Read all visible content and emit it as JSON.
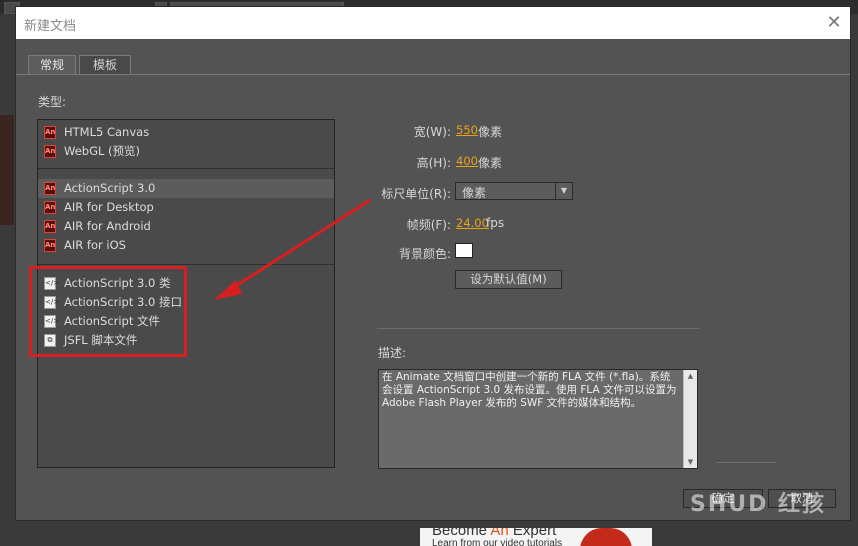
{
  "dialog": {
    "title": "新建文档",
    "close_glyph": "✕"
  },
  "tabs": [
    {
      "label": "常规"
    },
    {
      "label": "模板"
    }
  ],
  "type_section": {
    "label": "类型:",
    "items": [
      {
        "label": "HTML5 Canvas",
        "icon": "animate-document-icon",
        "icon_text": "An"
      },
      {
        "label": "WebGL (预览)",
        "icon": "animate-document-icon",
        "icon_text": "An"
      },
      {
        "label": "ActionScript 3.0",
        "icon": "animate-document-icon",
        "icon_text": "An",
        "selected": true
      },
      {
        "label": "AIR for Desktop",
        "icon": "animate-document-icon",
        "icon_text": "An"
      },
      {
        "label": "AIR for Android",
        "icon": "animate-document-icon",
        "icon_text": "An"
      },
      {
        "label": "AIR for iOS",
        "icon": "animate-document-icon",
        "icon_text": "An"
      },
      {
        "label": "ActionScript 3.0 类",
        "icon": "script-file-icon",
        "icon_text": "</>"
      },
      {
        "label": "ActionScript 3.0 接口",
        "icon": "script-file-icon",
        "icon_text": "</>"
      },
      {
        "label": "ActionScript 文件",
        "icon": "script-file-icon",
        "icon_text": "</>"
      },
      {
        "label": "JSFL 脚本文件",
        "icon": "jsfl-file-icon",
        "icon_text": "⧉"
      }
    ]
  },
  "properties": {
    "width_label": "宽(W):",
    "width_value": "550",
    "width_unit": "像素",
    "height_label": "高(H):",
    "height_value": "400",
    "height_unit": "像素",
    "ruler_label": "标尺单位(R):",
    "ruler_value": "像素",
    "fps_label": "帧频(F):",
    "fps_value": "24.00",
    "fps_unit": "fps",
    "bgcolor_label": "背景颜色:",
    "bgcolor_value": "#ffffff",
    "default_button": "设为默认值(M)"
  },
  "description": {
    "label": "描述:",
    "text": "在 Animate 文档窗口中创建一个新的 FLA 文件 (*.fla)。系统会设置 ActionScript 3.0 发布设置。使用 FLA 文件可以设置为 Adobe Flash Player 发布的 SWF 文件的媒体和结构。"
  },
  "buttons": {
    "ok": "确定",
    "cancel": "取消"
  },
  "background_ad": {
    "headline_a": "Become ",
    "headline_b": "An",
    "headline_c": " Expert",
    "subline": "Learn from our video tutorials"
  },
  "watermark": "SHUD 红孩"
}
